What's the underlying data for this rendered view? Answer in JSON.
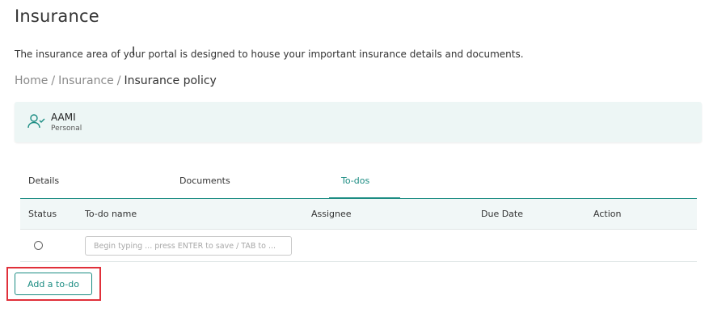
{
  "page": {
    "title": "Insurance",
    "intro": "The insurance area of your portal is designed to house your important insurance details and documents."
  },
  "breadcrumb": {
    "items": [
      "Home",
      "Insurance",
      "Insurance policy"
    ],
    "separator": "/"
  },
  "entity": {
    "name": "AAMI",
    "type": "Personal",
    "icon": "user-check-icon"
  },
  "tabs": [
    {
      "label": "Details",
      "active": false
    },
    {
      "label": "Documents",
      "active": false
    },
    {
      "label": "To-dos",
      "active": true
    }
  ],
  "table": {
    "columns": [
      "Status",
      "To-do name",
      "Assignee",
      "Due Date",
      "Action"
    ],
    "new_row": {
      "placeholder": "Begin typing ... press ENTER to save / TAB to ..."
    }
  },
  "actions": {
    "add_todo_label": "Add a to-do"
  },
  "colors": {
    "accent": "#1b8c82",
    "card_bg": "#edf6f5",
    "highlight": "#e0303a"
  }
}
